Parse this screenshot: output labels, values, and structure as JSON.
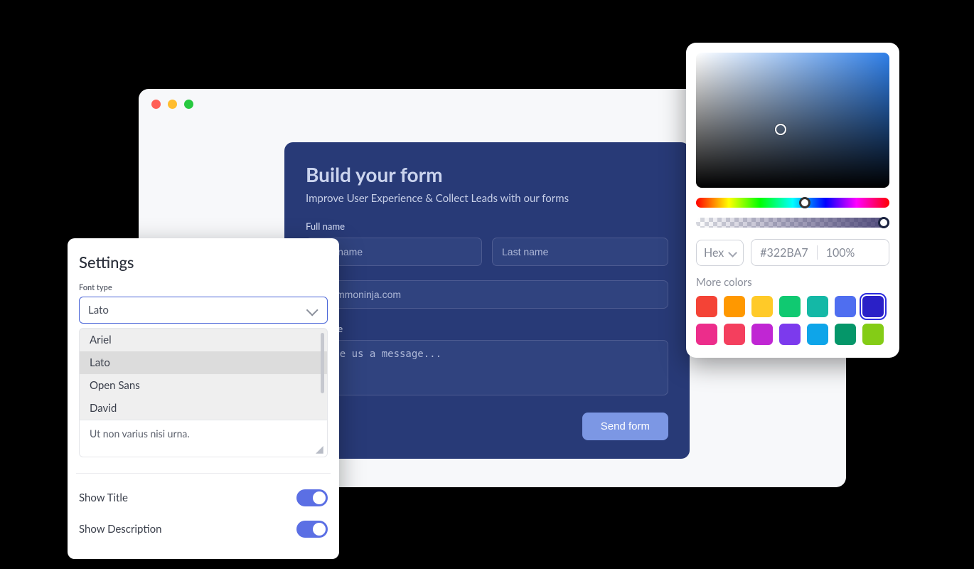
{
  "form": {
    "title": "Build your form",
    "subtitle": "Improve User Experience & Collect Leads with our forms",
    "fullNameLabel": "Full name",
    "firstNamePlaceholder": "First name",
    "lastNamePlaceholder": "Last name",
    "emailPlaceholder": "@commoninja.com",
    "messageLabel": "Message",
    "messagePlaceholder": "Leave us a message...",
    "submitLabel": "Send form"
  },
  "settings": {
    "title": "Settings",
    "fontTypeLabel": "Font type",
    "selectedFont": "Lato",
    "fontOptions": [
      "Ariel",
      "Lato",
      "Open Sans",
      "David"
    ],
    "stubText": "Ut non varius nisi urna.",
    "showTitleLabel": "Show Title",
    "showTitleOn": true,
    "showDescriptionLabel": "Show Description",
    "showDescriptionOn": true
  },
  "picker": {
    "formatLabel": "Hex",
    "hexValue": "#322BA7",
    "alphaValue": "100%",
    "moreColorsLabel": "More colors",
    "swatches": [
      "#f44336",
      "#ff9800",
      "#ffca28",
      "#10c971",
      "#14b8a6",
      "#4f6ef0",
      "#2a20c7",
      "#ec2d8b",
      "#f43f5e",
      "#c026d3",
      "#7c3aed",
      "#0ea5e9",
      "#059669",
      "#84cc16"
    ],
    "activeSwatchIndex": 6
  }
}
